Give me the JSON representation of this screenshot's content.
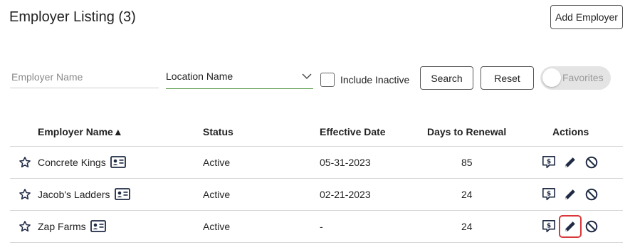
{
  "header": {
    "title": "Employer Listing (3)",
    "add_label": "Add Employer"
  },
  "filters": {
    "employer_name_placeholder": "Employer Name",
    "location_value": "Location Name",
    "include_inactive_label": "Include Inactive",
    "include_inactive_checked": false,
    "search_label": "Search",
    "reset_label": "Reset",
    "favorites_label": "Favorites",
    "favorites_on": false
  },
  "table": {
    "columns": [
      "Employer Name▲",
      "Status",
      "Effective Date",
      "Days to Renewal",
      "Actions"
    ],
    "rows": [
      {
        "name": "Concrete Kings",
        "status": "Active",
        "effective": "05-31-2023",
        "days": "85"
      },
      {
        "name": "Jacob's Ladders",
        "status": "Active",
        "effective": "02-21-2023",
        "days": "24"
      },
      {
        "name": "Zap Farms",
        "status": "Active",
        "effective": "-",
        "days": "24"
      }
    ]
  },
  "icons": {
    "favorite": "star-outline-icon",
    "contact": "contact-card-icon",
    "quote": "dollar-chat-icon",
    "edit": "pencil-icon",
    "deactivate": "ban-icon",
    "dropdown": "chevron-down-icon"
  },
  "colors": {
    "select_underline": "#5a9a4a",
    "icon_navy": "#1f2a44",
    "highlight": "#d9383a"
  }
}
